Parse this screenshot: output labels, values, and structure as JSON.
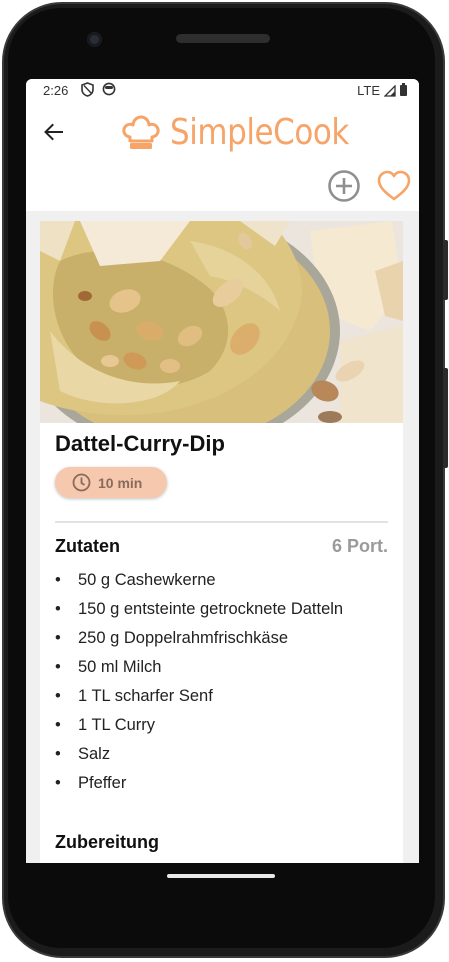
{
  "status_bar": {
    "time": "2:26",
    "left_icons": [
      "shield-icon",
      "face-icon"
    ],
    "network": "LTE",
    "right_icons": [
      "signal-icon",
      "battery-icon"
    ]
  },
  "app_bar": {
    "logo_text": "SimpleCook",
    "logo_icon": "chef-hat-icon",
    "back_icon": "arrow-back-icon",
    "add_icon": "add-circle-icon",
    "favorite_icon": "heart-outline-icon"
  },
  "recipe": {
    "image_alt": "hummus-with-nuts-photo",
    "title": "Dattel-Curry-Dip",
    "time": "10 min",
    "time_icon": "clock-icon",
    "ingredients_heading": "Zutaten",
    "portions": "6 Port.",
    "ingredients": [
      "50 g Cashewkerne",
      "150 g entsteinte getrocknete Datteln",
      "250 g Doppelrahmfrischkäse",
      "50 ml Milch",
      "1 TL scharfer Senf",
      "1 TL Curry",
      "Salz",
      "Pfeffer"
    ],
    "preparation_heading": "Zubereitung"
  },
  "colors": {
    "accent": "#f6a467",
    "chip": "#f6c9ae",
    "muted": "#9a9a9a"
  }
}
